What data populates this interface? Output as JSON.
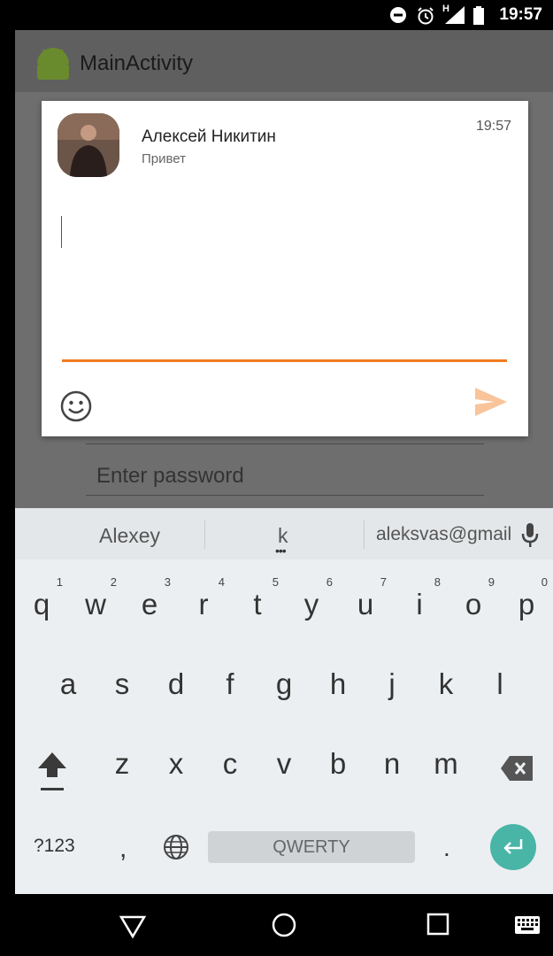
{
  "status_bar": {
    "time": "19:57",
    "network_label": "H",
    "icons": [
      "do-not-disturb-icon",
      "alarm-icon",
      "signal-icon",
      "battery-icon"
    ]
  },
  "app_bar": {
    "title": "MainActivity",
    "icon": "android-icon"
  },
  "background_form": {
    "password_placeholder": "Enter password"
  },
  "popup": {
    "sender": "Алексей Никитин",
    "message": "Привет",
    "time": "19:57",
    "reply_value": "",
    "accent_color": "#f27c22",
    "send_color": "#f9c49a"
  },
  "keyboard": {
    "suggestions": [
      "Alexey",
      "k",
      "aleksvas@gmail"
    ],
    "row1": [
      {
        "key": "q",
        "hint": "1"
      },
      {
        "key": "w",
        "hint": "2"
      },
      {
        "key": "e",
        "hint": "3"
      },
      {
        "key": "r",
        "hint": "4"
      },
      {
        "key": "t",
        "hint": "5"
      },
      {
        "key": "y",
        "hint": "6"
      },
      {
        "key": "u",
        "hint": "7"
      },
      {
        "key": "i",
        "hint": "8"
      },
      {
        "key": "o",
        "hint": "9"
      },
      {
        "key": "p",
        "hint": "0"
      }
    ],
    "row2": [
      "a",
      "s",
      "d",
      "f",
      "g",
      "h",
      "j",
      "k",
      "l"
    ],
    "row3": [
      "z",
      "x",
      "c",
      "v",
      "b",
      "n",
      "m"
    ],
    "symbols_key": "?123",
    "comma_key": ",",
    "space_label": "QWERTY",
    "period_key": ".",
    "enter_color": "#48b5a6"
  },
  "nav_bar": {
    "buttons": [
      "back-icon",
      "home-icon",
      "recents-icon",
      "keyboard-switch-icon"
    ]
  }
}
